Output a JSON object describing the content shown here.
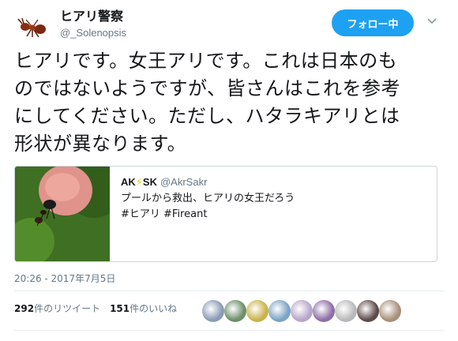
{
  "user": {
    "display_name": "ヒアリ警察",
    "handle": "@_Solenopsis",
    "avatar_icon": "ant-icon"
  },
  "follow_button": {
    "label": "フォロー中",
    "color": "#1da1f2"
  },
  "menu_icon": "chevron-down-icon",
  "tweet": {
    "lines": [
      "ヒアリです。女王アリです。これは日本のも",
      "のではないようですが、皆さんはこれを参考",
      "にしてください。ただし、ハタラキアリとは",
      "形状が異なります。"
    ]
  },
  "quote": {
    "author_name_1": "AK",
    "author_bolt": "⚡",
    "author_name_2": "SK",
    "author_handle": "@AkrSakr",
    "text": "プールから救出、ヒアリの女王だろう",
    "hashtags": "#ヒアリ #Fireant",
    "media_icon": "ant-on-finger-photo"
  },
  "timestamp": "20:26 - 2017年7月5日",
  "stats": {
    "retweets_count": "292",
    "retweets_label": "件のリツイート",
    "likes_count": "151",
    "likes_label": "件のいいね"
  },
  "liker_avatars": [
    {
      "color": "#8a9bb5"
    },
    {
      "color": "#6c8f6a"
    },
    {
      "color": "#c9b24a"
    },
    {
      "color": "#7aa3c4"
    },
    {
      "color": "#b7a6c9"
    },
    {
      "color": "#8d6ea8"
    },
    {
      "color": "#b9b9b9"
    },
    {
      "color": "#5e4a4a"
    },
    {
      "color": "#a88f7a"
    }
  ]
}
